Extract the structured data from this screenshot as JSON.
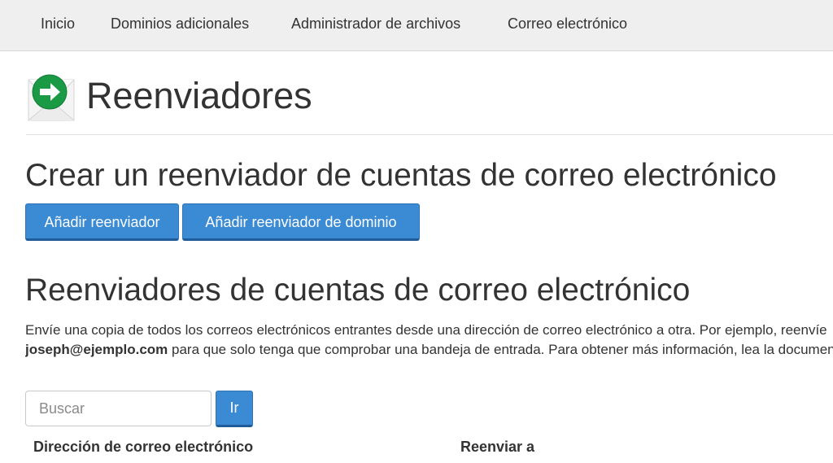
{
  "nav": {
    "items": [
      {
        "label": "Inicio"
      },
      {
        "label": "Dominios adicionales"
      },
      {
        "label": "Administrador de archivos"
      },
      {
        "label": "Correo electrónico"
      }
    ]
  },
  "header": {
    "icon": "forwarder-envelope-icon",
    "title": "Reenviadores"
  },
  "create_section": {
    "title": "Crear un reenviador de cuentas de correo electrónico",
    "add_forwarder_label": "Añadir reenviador",
    "add_domain_forwarder_label": "Añadir reenviador de dominio"
  },
  "list_section": {
    "title": "Reenviadores de cuentas de correo electrónico",
    "desc_line1": "Envíe una copia de todos los correos electrónicos entrantes desde una dirección de correo electrónico a otra. Por ejemplo, reenvíe",
    "desc_email": "joseph@ejemplo.com",
    "desc_line2_rest": " para que solo tenga que comprobar una bandeja de entrada. Para obtener más información, lea la documentación."
  },
  "search": {
    "placeholder": "Buscar",
    "value": "",
    "go_label": "Ir"
  },
  "table": {
    "columns": [
      "Dirección de correo electrónico",
      "Reenviar a"
    ]
  },
  "colors": {
    "accent": "#3a8ad4",
    "nav_bg": "#efefef",
    "icon_green": "#1a9a44"
  }
}
